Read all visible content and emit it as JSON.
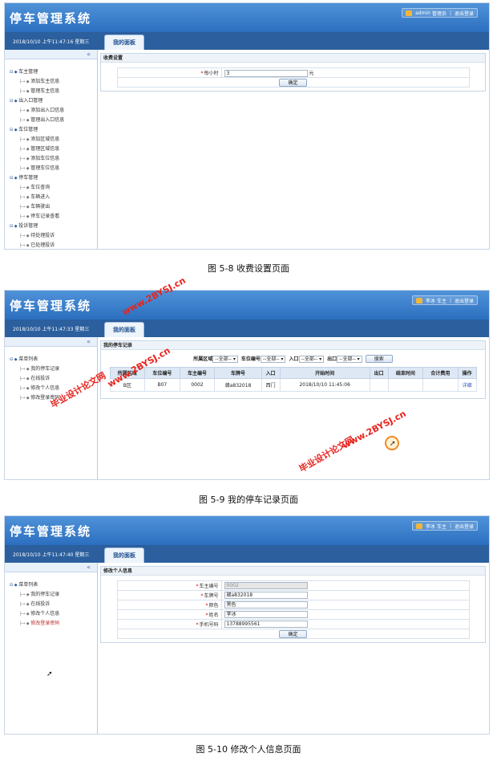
{
  "app_title": "停车管理系统",
  "tab_label": "我的面板",
  "collapse_symbol": "«",
  "shots": [
    {
      "user_name": "admin",
      "user_role": "管理员",
      "logout": "退出登录",
      "datetime": "2018/10/10 上午11:47:16 星期三",
      "menu": [
        {
          "label": "车主管理",
          "kind": "group"
        },
        {
          "label": "添加车主信息",
          "kind": "child"
        },
        {
          "label": "管理车主信息",
          "kind": "child"
        },
        {
          "label": "出入口管理",
          "kind": "group"
        },
        {
          "label": "添加出入口信息",
          "kind": "child"
        },
        {
          "label": "管理出入口信息",
          "kind": "child"
        },
        {
          "label": "车位管理",
          "kind": "group"
        },
        {
          "label": "添加区域信息",
          "kind": "child"
        },
        {
          "label": "管理区域信息",
          "kind": "child"
        },
        {
          "label": "添加车位信息",
          "kind": "child"
        },
        {
          "label": "管理车位信息",
          "kind": "child"
        },
        {
          "label": "停车管理",
          "kind": "group"
        },
        {
          "label": "车位查询",
          "kind": "child"
        },
        {
          "label": "车辆进入",
          "kind": "child"
        },
        {
          "label": "车辆驶出",
          "kind": "child"
        },
        {
          "label": "停车记录查看",
          "kind": "child"
        },
        {
          "label": "投诉管理",
          "kind": "group"
        },
        {
          "label": "待处理投诉",
          "kind": "child"
        },
        {
          "label": "已处理投诉",
          "kind": "child"
        }
      ],
      "panel_title": "收费设置",
      "field_label": "每小时",
      "field_value": "3",
      "field_unit": "元",
      "button": "确定",
      "caption": "图 5-8 收费设置页面"
    },
    {
      "user_name": "李冰",
      "user_role": "车主",
      "logout": "退出登录",
      "datetime": "2018/10/10 上午11:47:33 星期三",
      "menu": [
        {
          "label": "菜单列表",
          "kind": "group"
        },
        {
          "label": "我的停车记录",
          "kind": "child"
        },
        {
          "label": "在线投诉",
          "kind": "child"
        },
        {
          "label": "修改个人信息",
          "kind": "child"
        },
        {
          "label": "修改登录密码",
          "kind": "child"
        }
      ],
      "panel_title": "我的停车记录",
      "filters": [
        {
          "label": "所属区域",
          "value": "--全部--"
        },
        {
          "label": "车位编号",
          "value": "--全部--"
        },
        {
          "label": "入口",
          "value": "--全部--"
        },
        {
          "label": "出口",
          "value": "--全部--"
        }
      ],
      "search_button": "搜索",
      "columns": [
        "所属区域",
        "车位编号",
        "车主编号",
        "车牌号",
        "入口",
        "开始时间",
        "出口",
        "结束时间",
        "合计费用",
        "操作"
      ],
      "rows": [
        [
          "B区",
          "B07",
          "0002",
          "赣a832018",
          "西门",
          "2018/10/10 11:45:06",
          "",
          "",
          "",
          "详细"
        ]
      ],
      "caption": "图 5-9 我的停车记录页面"
    },
    {
      "user_name": "李冰",
      "user_role": "车主",
      "logout": "退出登录",
      "datetime": "2018/10/10 上午11:47:40 星期三",
      "menu": [
        {
          "label": "菜单列表",
          "kind": "group"
        },
        {
          "label": "我的停车记录",
          "kind": "child"
        },
        {
          "label": "在线投诉",
          "kind": "child"
        },
        {
          "label": "修改个人信息",
          "kind": "child"
        },
        {
          "label": "修改登录密码",
          "kind": "child",
          "active": true
        }
      ],
      "panel_title": "修改个人信息",
      "fields": [
        {
          "label": "车主编号",
          "value": "0002",
          "readonly": true
        },
        {
          "label": "车牌号",
          "value": "赣a832018"
        },
        {
          "label": "颜色",
          "value": "黑色"
        },
        {
          "label": "姓名",
          "value": "李冰"
        },
        {
          "label": "手机号码",
          "value": "13788995561"
        }
      ],
      "button": "确定",
      "caption": "图 5-10 修改个人信息页面"
    }
  ],
  "watermarks": {
    "site": "www.2BYSJ.cn",
    "brand": "毕业设计论文网"
  }
}
